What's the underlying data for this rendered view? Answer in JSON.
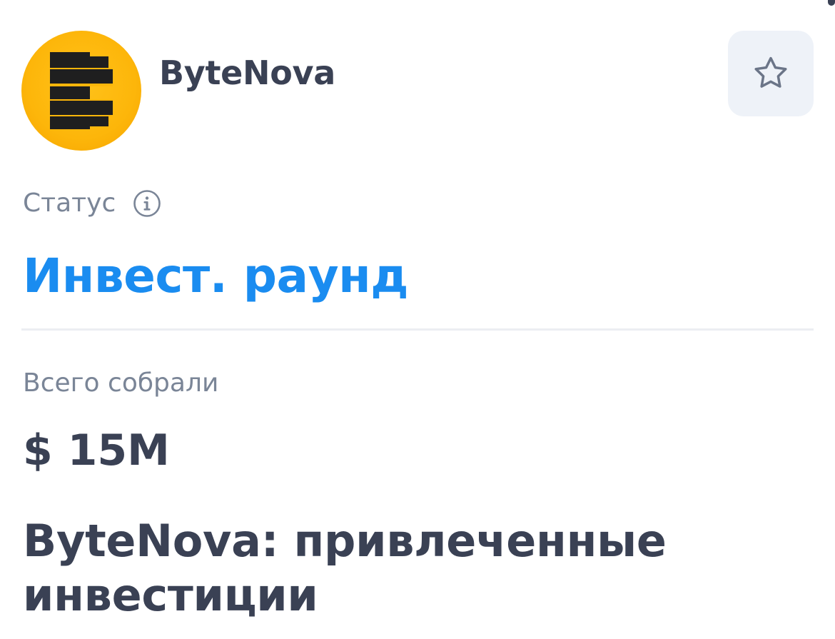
{
  "header": {
    "project_name": "ByteNova",
    "logo_icon": "bytenova-logo",
    "favorite_icon": "star-outline-icon"
  },
  "status": {
    "label": "Статус",
    "info_icon": "info-icon",
    "value": "Инвест. раунд"
  },
  "funding": {
    "label": "Всего собрали",
    "value": "$ 15M"
  },
  "section": {
    "heading": "ByteNova: привлеченные инвестиции"
  },
  "colors": {
    "accent_blue": "#1a8cf0",
    "text_dark": "#3a4154",
    "text_muted": "#7a8597",
    "logo_yellow": "#fdb60a",
    "button_bg": "#eef2f8"
  }
}
